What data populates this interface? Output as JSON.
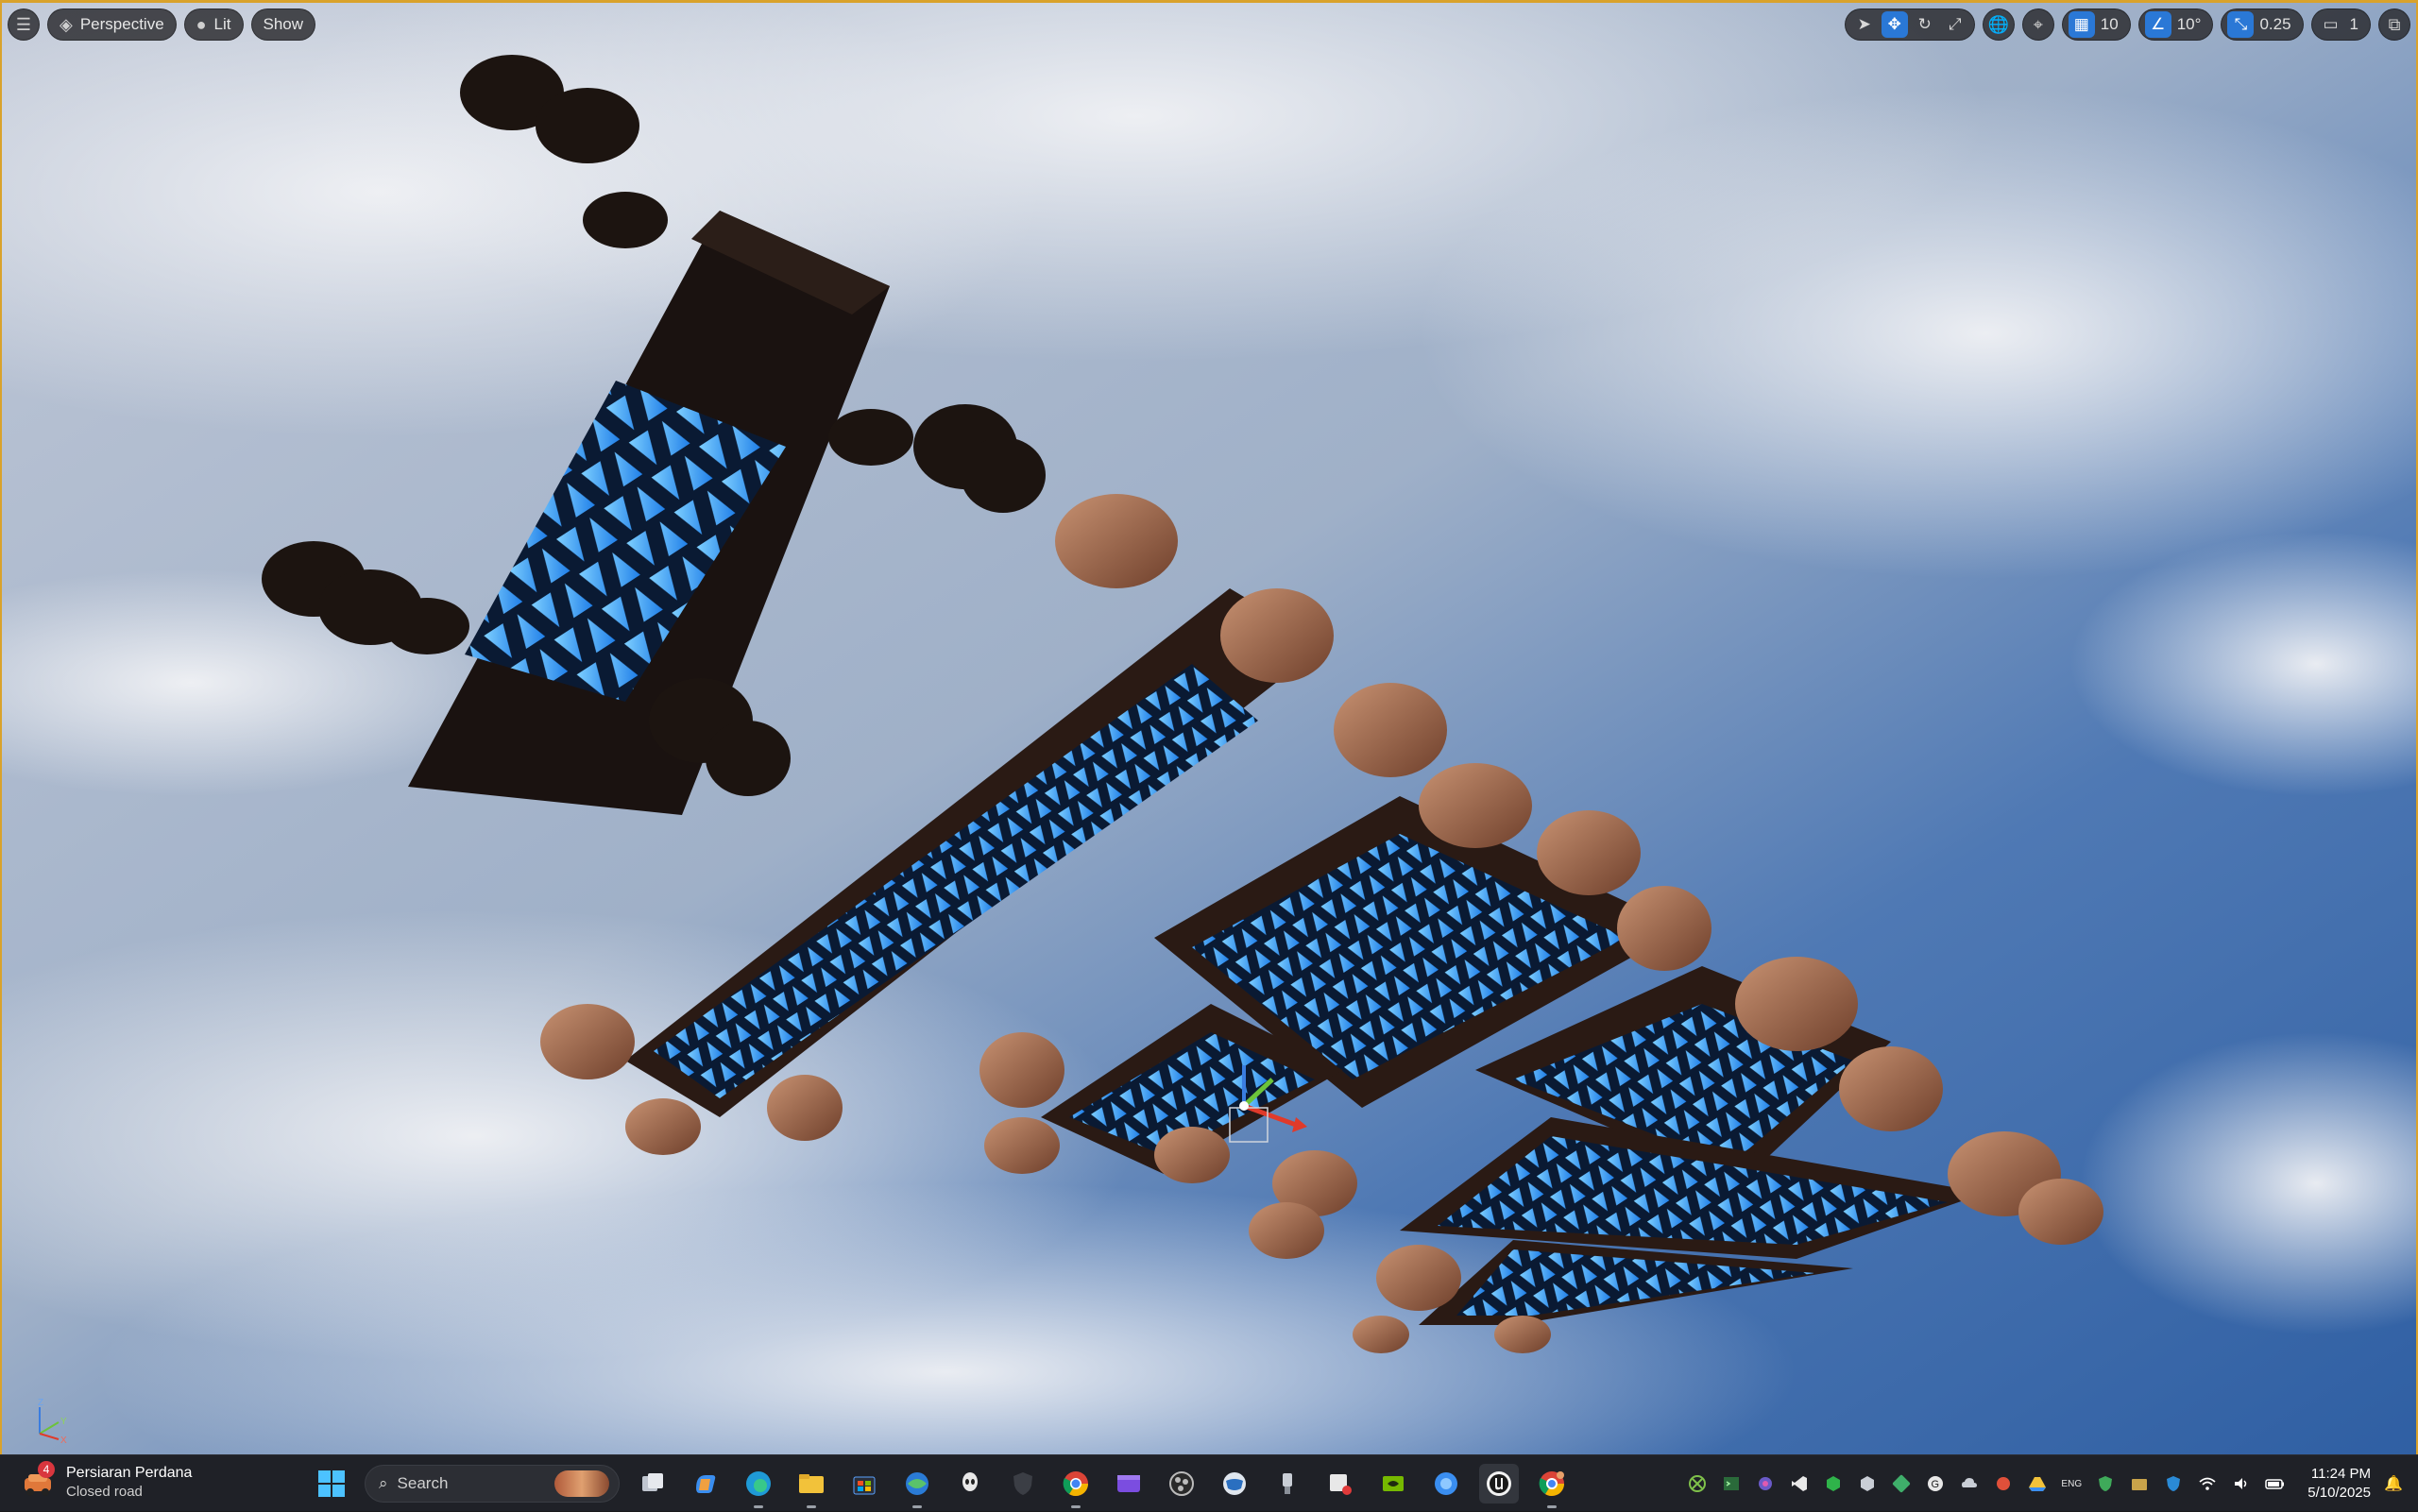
{
  "viewport": {
    "toolbar_left": {
      "menu_icon": "hamburger-icon",
      "perspective_label": "Perspective",
      "lit_label": "Lit",
      "show_label": "Show"
    },
    "toolbar_right": {
      "select_icon": "cursor-icon",
      "translate_icon": "move-icon",
      "rotate_icon": "rotate-icon",
      "scale_icon": "scale-icon",
      "world_icon": "globe-icon",
      "surface_snap_icon": "surface-snap-icon",
      "grid_snap_value": "10",
      "rotation_snap_value": "10°",
      "scale_snap_value": "0.25",
      "camera_speed_value": "1",
      "maximize_icon": "maximize-icon"
    },
    "accent_color": "#d9a22b",
    "active_color": "#2a78d6"
  },
  "taskbar": {
    "weather": {
      "badge_count": "4",
      "location": "Persiaran Perdana",
      "status": "Closed road"
    },
    "search_placeholder": "Search",
    "apps": [
      "windows-start",
      "search",
      "task-view",
      "copilot",
      "edge",
      "file-explorer",
      "microsoft-store",
      "web-browser",
      "alien-app",
      "shield-app",
      "chrome",
      "clipchamp",
      "obs",
      "globe-app",
      "usb-app",
      "snipping-tool",
      "nvidia",
      "photos",
      "unreal-engine",
      "chrome-profile"
    ],
    "tray_icons": [
      "xbox-icon",
      "terminal-icon",
      "app-icon",
      "vscode-icon",
      "green-app-icon",
      "security-icon",
      "green-app-2-icon",
      "grammarly-icon",
      "cloud-icon",
      "red-app-icon",
      "drive-icon",
      "ime-icon",
      "shield-icon",
      "folder-icon",
      "defender-icon",
      "wifi-icon",
      "volume-icon",
      "battery-icon"
    ],
    "ime_label": "ENG",
    "time": "11:24 PM",
    "date": "5/10/2025"
  }
}
